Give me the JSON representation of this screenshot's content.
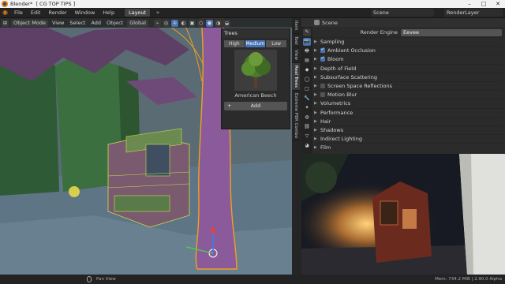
{
  "window": {
    "app": "Blender*",
    "file": "[ CG TOP TIPS ]",
    "buttons": [
      "–",
      "□",
      "✕"
    ]
  },
  "menu": [
    "File",
    "Edit",
    "Render",
    "Window",
    "Help"
  ],
  "workspace_tabs": [
    "Layout"
  ],
  "topbar": {
    "scene": "Scene",
    "view_layer": "RenderLayer"
  },
  "viewport_header": {
    "mode": "Object Mode",
    "menus": [
      "View",
      "Select",
      "Add",
      "Object"
    ],
    "orientation": "Global"
  },
  "trees_panel": {
    "title": "Trees",
    "tabs": [
      "High",
      "Medium",
      "Low"
    ],
    "selected_tab": "Medium",
    "item_name": "American Beech",
    "add_label": "Add"
  },
  "n_tabs": [
    "Item",
    "Tool",
    "View",
    "Real Trees",
    "Extreme PBR Combo"
  ],
  "properties": {
    "header_scene": "Scene",
    "render_engine_label": "Render Engine",
    "render_engine_value": "Eevee",
    "sections": [
      {
        "label": "Sampling",
        "checkbox": null
      },
      {
        "label": "Ambient Occlusion",
        "checkbox": true
      },
      {
        "label": "Bloom",
        "checkbox": true
      },
      {
        "label": "Depth of Field",
        "checkbox": null
      },
      {
        "label": "Subsurface Scattering",
        "checkbox": null
      },
      {
        "label": "Screen Space Reflections",
        "checkbox": false
      },
      {
        "label": "Motion Blur",
        "checkbox": false
      },
      {
        "label": "Volumetrics",
        "checkbox": null
      },
      {
        "label": "Performance",
        "checkbox": null
      },
      {
        "label": "Hair",
        "checkbox": null
      },
      {
        "label": "Shadows",
        "checkbox": null
      },
      {
        "label": "Indirect Lighting",
        "checkbox": null
      },
      {
        "label": "Film",
        "checkbox": null
      }
    ]
  },
  "statusbar": {
    "hint": "Pan View",
    "stats": "Mem: 734.2 MiB | 2.90.0 Alpha"
  },
  "colors": {
    "accent": "#4772b3",
    "logo": "#e87d0d",
    "selection_outline": "#f0a020",
    "trunk": "#8a5a9a"
  }
}
